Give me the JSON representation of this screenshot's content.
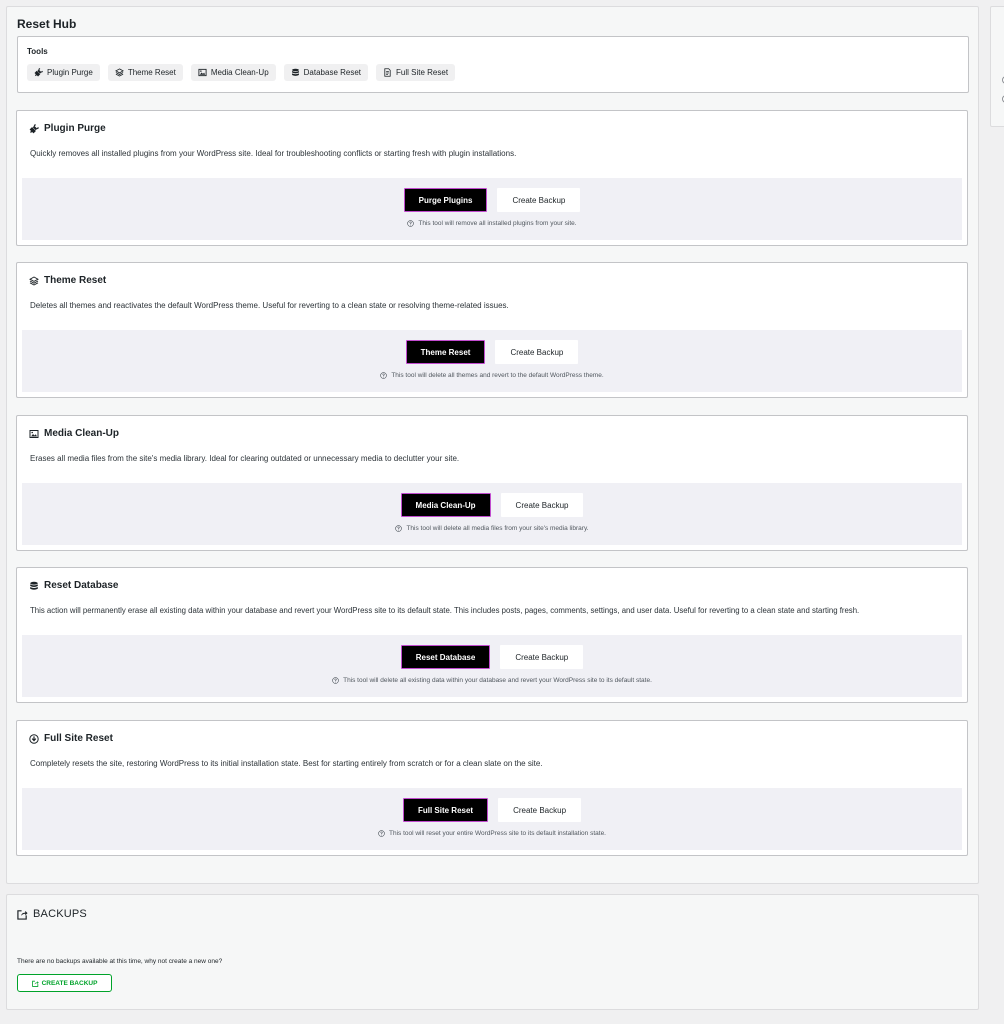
{
  "hub": {
    "title": "Reset Hub",
    "tools_label": "Tools",
    "tools": [
      {
        "label": "Plugin Purge",
        "icon": "plug-icon"
      },
      {
        "label": "Theme Reset",
        "icon": "layers-icon"
      },
      {
        "label": "Media Clean-Up",
        "icon": "image-icon"
      },
      {
        "label": "Database Reset",
        "icon": "database-icon"
      },
      {
        "label": "Full Site Reset",
        "icon": "document-icon"
      }
    ]
  },
  "panels": [
    {
      "title": "Plugin Purge",
      "icon": "plug-icon",
      "description": "Quickly removes all installed plugins from your WordPress site. Ideal for troubleshooting conflicts or starting fresh with plugin installations.",
      "primary_label": "Purge Plugins",
      "secondary_label": "Create Backup",
      "note": "This tool will remove all installed plugins from your site."
    },
    {
      "title": "Theme Reset",
      "icon": "layers-icon",
      "description": "Deletes all themes and reactivates the default WordPress theme. Useful for reverting to a clean state or resolving theme-related issues.",
      "primary_label": "Theme Reset",
      "secondary_label": "Create Backup",
      "note": "This tool will delete all themes and revert to the default WordPress theme."
    },
    {
      "title": "Media Clean-Up",
      "icon": "image-icon",
      "description": "Erases all media files from the site's media library. Ideal for clearing outdated or unnecessary media to declutter your site.",
      "primary_label": "Media Clean-Up",
      "secondary_label": "Create Backup",
      "note": "This tool will delete all media files from your site's media library."
    },
    {
      "title": "Reset Database",
      "icon": "database-icon",
      "description": "This action will permanently erase all existing data within your database and revert your WordPress site to its default state. This includes posts, pages, comments, settings, and user data. Useful for reverting to a clean state and starting fresh.",
      "primary_label": "Reset Database",
      "secondary_label": "Create Backup",
      "note": "This tool will delete all existing data within your database and revert your WordPress site to its default state."
    },
    {
      "title": "Full Site Reset",
      "icon": "download-circle-icon",
      "description": "Completely resets the site, restoring WordPress to its initial installation state. Best for starting entirely from scratch or for a clean slate on the site.",
      "primary_label": "Full Site Reset",
      "secondary_label": "Create Backup",
      "note": "This tool will reset your entire WordPress site to its default installation state."
    }
  ],
  "backups": {
    "title": "BACKUPS",
    "icon": "export-icon",
    "message": "There are no backups available at this time, why not create a new one?",
    "button_label": "CREATE BACKUP"
  },
  "colors": {
    "primary_button_bg": "#000000",
    "primary_button_border": "#c14bcf",
    "backup_green": "#00a32a",
    "action_area_bg": "#f0f0f5"
  }
}
